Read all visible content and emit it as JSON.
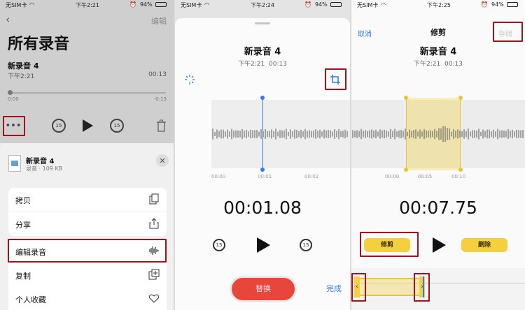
{
  "status_bars": [
    {
      "carrier": "无SIM卡",
      "time": "下午2:21",
      "battery": "94%"
    },
    {
      "carrier": "无SIM卡",
      "time": "下午2:24",
      "battery": "94%"
    },
    {
      "carrier": "无SIM卡",
      "time": "下午2:25",
      "battery": "94%"
    }
  ],
  "list_view": {
    "edit_label": "编辑",
    "title": "所有录音",
    "recording": {
      "name": "新录音 4",
      "time": "下午2:21",
      "duration": "00:13",
      "pos_start": "0:00",
      "pos_end": "-0:13"
    },
    "skip_back": "15",
    "skip_fwd": "15"
  },
  "share_sheet": {
    "file_name": "新录音 4",
    "file_meta": "录音 · 109 KB",
    "actions": [
      {
        "label": "拷贝",
        "icon": "copy-icon"
      },
      {
        "label": "分享",
        "icon": "share-icon"
      },
      {
        "label": "编辑录音",
        "icon": "waveform-icon"
      },
      {
        "label": "复制",
        "icon": "duplicate-icon"
      },
      {
        "label": "个人收藏",
        "icon": "heart-icon"
      }
    ]
  },
  "edit_view": {
    "name": "新录音 4",
    "time": "下午2:21",
    "duration": "00:13",
    "ticks": [
      "00:00",
      "00:01",
      "00:02"
    ],
    "timer": "00:01.08",
    "replace_label": "替换",
    "done_label": "完成",
    "skip_back": "15",
    "skip_fwd": "15",
    "playhead_fraction": 0.37
  },
  "trim_view": {
    "cancel_label": "取消",
    "title": "修剪",
    "save_label": "存储",
    "name": "新录音 4",
    "time": "下午2:21",
    "duration": "00:13",
    "ticks": [
      "00:00",
      "00:05",
      "00:10"
    ],
    "timer": "00:07.75",
    "trim_label": "修剪",
    "delete_label": "删除",
    "selection_start_fraction": 0.3,
    "selection_end_fraction": 0.73
  },
  "colors": {
    "accent_blue": "#3478f6",
    "trim_yellow": "#f4d03f",
    "red_button": "#e8463a",
    "highlight_box": "#a3121b"
  }
}
